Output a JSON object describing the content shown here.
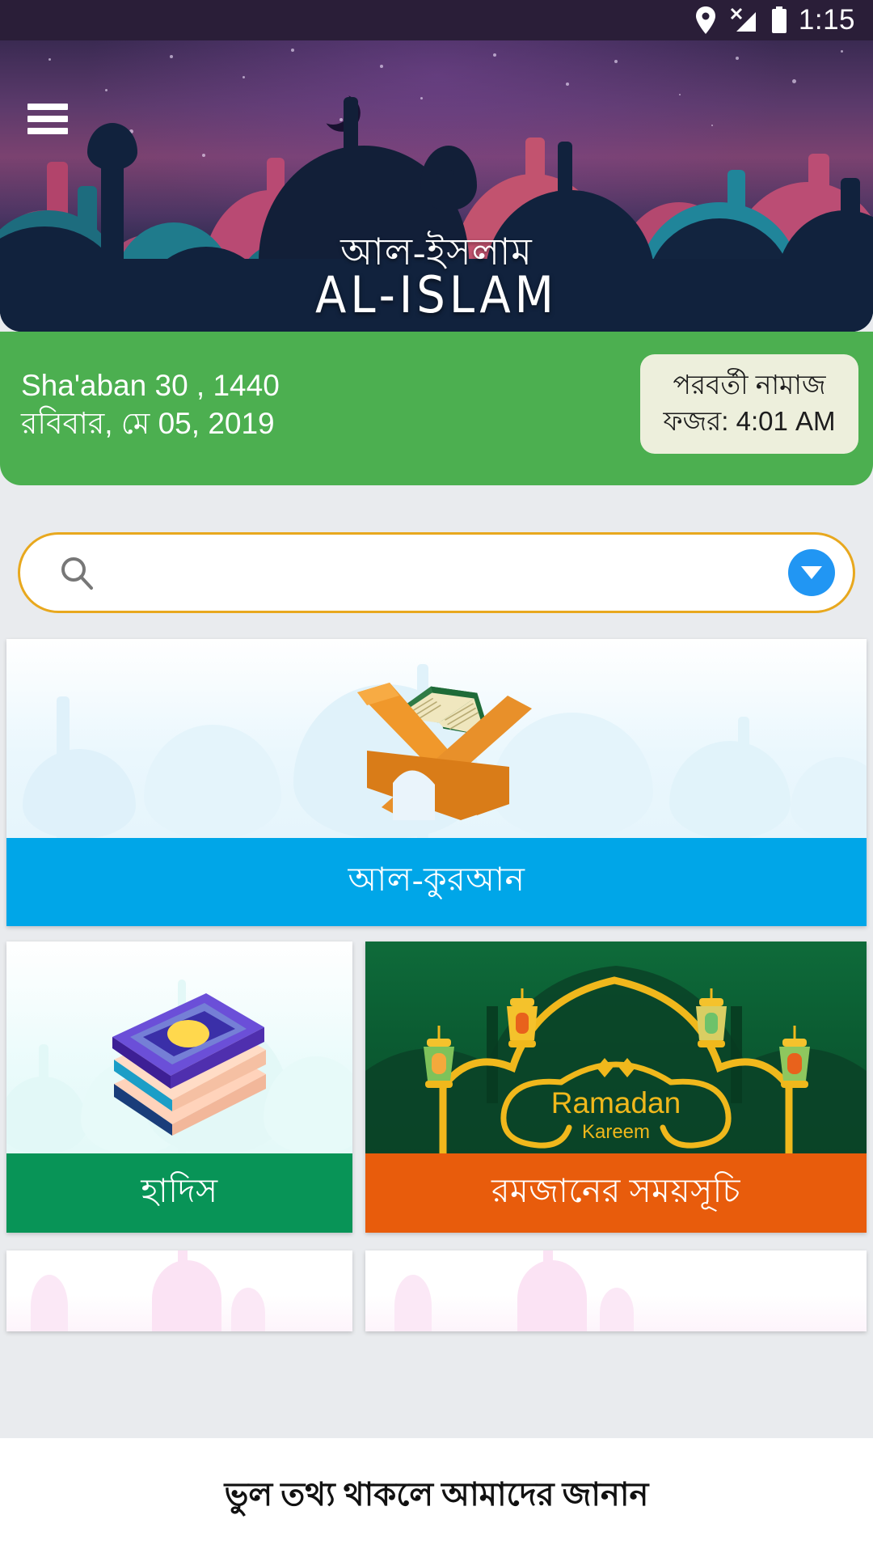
{
  "statusbar": {
    "time": "1:15",
    "icons": [
      "location-pin-icon",
      "signal-no-sim-icon",
      "battery-full-icon"
    ]
  },
  "header": {
    "menu_icon": "hamburger-menu-icon",
    "title_bn": "আল-ইসলাম",
    "title_en": "AL-ISLAM",
    "moon_icon": "crescent-moon-icon"
  },
  "datebar": {
    "hijri_date": "Sha'aban 30 , 1440",
    "gregorian_date": "রবিবার, মে 05, 2019",
    "next_prayer_label": "পরবর্তী নামাজ",
    "next_prayer_time": "ফজর: 4:01 AM",
    "bg_color": "#4caf50",
    "badge_color": "#edefdc"
  },
  "search": {
    "placeholder": "",
    "value": "",
    "icon": "search-icon",
    "dropdown_icon": "chevron-down-icon",
    "border_color": "#e8a81e",
    "dropdown_color": "#2196f3"
  },
  "cards": [
    {
      "id": "quran",
      "label": "আল-কুরআন",
      "label_color": "#00a6e8",
      "image": "quran-on-rehal-illustration"
    },
    {
      "id": "hadith",
      "label": "হাদিস",
      "label_color": "#089457",
      "image": "stacked-books-illustration"
    },
    {
      "id": "ramadan",
      "label": "রমজানের সময়সূচি",
      "label_color": "#e85c0c",
      "image": "ramadan-kareem-lanterns-illustration",
      "image_text_line1": "Ramadan",
      "image_text_line2": "Kareem"
    }
  ],
  "footer": {
    "text": "ভুল তথ্য থাকলে আমাদের জানান"
  }
}
